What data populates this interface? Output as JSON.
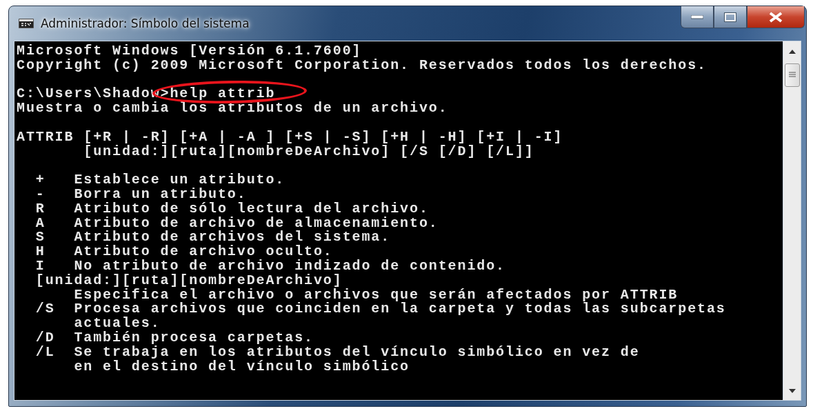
{
  "window": {
    "title": "Administrador: Símbolo del sistema"
  },
  "caption_buttons": [
    {
      "kind": "minimize"
    },
    {
      "kind": "maximize"
    },
    {
      "kind": "close"
    }
  ],
  "console": {
    "blocks": [
      [
        "Microsoft Windows [Versión 6.1.7600]",
        "Copyright (c) 2009 Microsoft Corporation. Reservados todos los derechos."
      ],
      [
        "C:\\Users\\Shadow>help attrib",
        "Muestra o cambia los atributos de un archivo."
      ],
      [
        "ATTRIB [+R | -R] [+A | -A ] [+S | -S] [+H | -H] [+I | -I]",
        "       [unidad:][ruta][nombreDeArchivo] [/S [/D] [/L]]"
      ],
      [
        "  +   Establece un atributo.",
        "  -   Borra un atributo.",
        "  R   Atributo de sólo lectura del archivo.",
        "  A   Atributo de archivo de almacenamiento.",
        "  S   Atributo de archivos del sistema.",
        "  H   Atributo de archivo oculto.",
        "  I   No atributo de archivo indizado de contenido.",
        "  [unidad:][ruta][nombreDeArchivo]",
        "      Especifica el archivo o archivos que serán afectados por ATTRIB",
        "  /S  Procesa archivos que coinciden en la carpeta y todas las subcarpetas",
        "      actuales.",
        "  /D  También procesa carpetas.",
        "  /L  Se trabaja en los atributos del vínculo simbólico en vez de",
        "      en el destino del vínculo simbólico"
      ]
    ]
  },
  "annotations": [
    {
      "kind": "ellipse"
    }
  ]
}
